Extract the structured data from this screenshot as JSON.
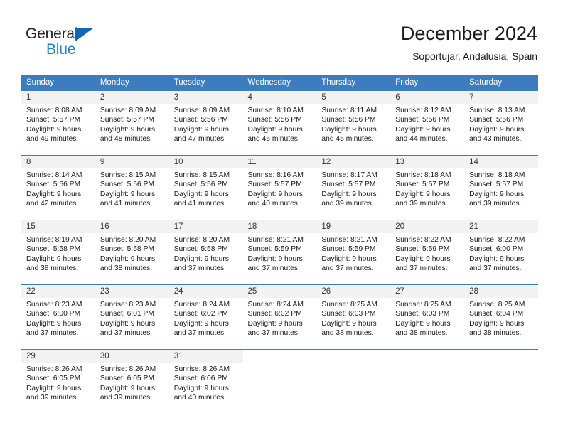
{
  "logo": {
    "text_primary": "General",
    "text_secondary": "Blue",
    "triangle_color": "#1266b5",
    "secondary_color": "#1783d0"
  },
  "header": {
    "title": "December 2024",
    "subtitle": "Soportujar, Andalusia, Spain"
  },
  "theme": {
    "header_blue": "#3d7dbf",
    "daynum_strip_bg": "#f2f2f2",
    "cell_bg": "#ffffff",
    "text": "#1a1a1a"
  },
  "weekday_headers": [
    "Sunday",
    "Monday",
    "Tuesday",
    "Wednesday",
    "Thursday",
    "Friday",
    "Saturday"
  ],
  "weeks": [
    [
      {
        "day": "1",
        "sunrise": "Sunrise: 8:08 AM",
        "sunset": "Sunset: 5:57 PM",
        "daylight_1": "Daylight: 9 hours",
        "daylight_2": "and 49 minutes."
      },
      {
        "day": "2",
        "sunrise": "Sunrise: 8:09 AM",
        "sunset": "Sunset: 5:57 PM",
        "daylight_1": "Daylight: 9 hours",
        "daylight_2": "and 48 minutes."
      },
      {
        "day": "3",
        "sunrise": "Sunrise: 8:09 AM",
        "sunset": "Sunset: 5:56 PM",
        "daylight_1": "Daylight: 9 hours",
        "daylight_2": "and 47 minutes."
      },
      {
        "day": "4",
        "sunrise": "Sunrise: 8:10 AM",
        "sunset": "Sunset: 5:56 PM",
        "daylight_1": "Daylight: 9 hours",
        "daylight_2": "and 46 minutes."
      },
      {
        "day": "5",
        "sunrise": "Sunrise: 8:11 AM",
        "sunset": "Sunset: 5:56 PM",
        "daylight_1": "Daylight: 9 hours",
        "daylight_2": "and 45 minutes."
      },
      {
        "day": "6",
        "sunrise": "Sunrise: 8:12 AM",
        "sunset": "Sunset: 5:56 PM",
        "daylight_1": "Daylight: 9 hours",
        "daylight_2": "and 44 minutes."
      },
      {
        "day": "7",
        "sunrise": "Sunrise: 8:13 AM",
        "sunset": "Sunset: 5:56 PM",
        "daylight_1": "Daylight: 9 hours",
        "daylight_2": "and 43 minutes."
      }
    ],
    [
      {
        "day": "8",
        "sunrise": "Sunrise: 8:14 AM",
        "sunset": "Sunset: 5:56 PM",
        "daylight_1": "Daylight: 9 hours",
        "daylight_2": "and 42 minutes."
      },
      {
        "day": "9",
        "sunrise": "Sunrise: 8:15 AM",
        "sunset": "Sunset: 5:56 PM",
        "daylight_1": "Daylight: 9 hours",
        "daylight_2": "and 41 minutes."
      },
      {
        "day": "10",
        "sunrise": "Sunrise: 8:15 AM",
        "sunset": "Sunset: 5:56 PM",
        "daylight_1": "Daylight: 9 hours",
        "daylight_2": "and 41 minutes."
      },
      {
        "day": "11",
        "sunrise": "Sunrise: 8:16 AM",
        "sunset": "Sunset: 5:57 PM",
        "daylight_1": "Daylight: 9 hours",
        "daylight_2": "and 40 minutes."
      },
      {
        "day": "12",
        "sunrise": "Sunrise: 8:17 AM",
        "sunset": "Sunset: 5:57 PM",
        "daylight_1": "Daylight: 9 hours",
        "daylight_2": "and 39 minutes."
      },
      {
        "day": "13",
        "sunrise": "Sunrise: 8:18 AM",
        "sunset": "Sunset: 5:57 PM",
        "daylight_1": "Daylight: 9 hours",
        "daylight_2": "and 39 minutes."
      },
      {
        "day": "14",
        "sunrise": "Sunrise: 8:18 AM",
        "sunset": "Sunset: 5:57 PM",
        "daylight_1": "Daylight: 9 hours",
        "daylight_2": "and 39 minutes."
      }
    ],
    [
      {
        "day": "15",
        "sunrise": "Sunrise: 8:19 AM",
        "sunset": "Sunset: 5:58 PM",
        "daylight_1": "Daylight: 9 hours",
        "daylight_2": "and 38 minutes."
      },
      {
        "day": "16",
        "sunrise": "Sunrise: 8:20 AM",
        "sunset": "Sunset: 5:58 PM",
        "daylight_1": "Daylight: 9 hours",
        "daylight_2": "and 38 minutes."
      },
      {
        "day": "17",
        "sunrise": "Sunrise: 8:20 AM",
        "sunset": "Sunset: 5:58 PM",
        "daylight_1": "Daylight: 9 hours",
        "daylight_2": "and 37 minutes."
      },
      {
        "day": "18",
        "sunrise": "Sunrise: 8:21 AM",
        "sunset": "Sunset: 5:59 PM",
        "daylight_1": "Daylight: 9 hours",
        "daylight_2": "and 37 minutes."
      },
      {
        "day": "19",
        "sunrise": "Sunrise: 8:21 AM",
        "sunset": "Sunset: 5:59 PM",
        "daylight_1": "Daylight: 9 hours",
        "daylight_2": "and 37 minutes."
      },
      {
        "day": "20",
        "sunrise": "Sunrise: 8:22 AM",
        "sunset": "Sunset: 5:59 PM",
        "daylight_1": "Daylight: 9 hours",
        "daylight_2": "and 37 minutes."
      },
      {
        "day": "21",
        "sunrise": "Sunrise: 8:22 AM",
        "sunset": "Sunset: 6:00 PM",
        "daylight_1": "Daylight: 9 hours",
        "daylight_2": "and 37 minutes."
      }
    ],
    [
      {
        "day": "22",
        "sunrise": "Sunrise: 8:23 AM",
        "sunset": "Sunset: 6:00 PM",
        "daylight_1": "Daylight: 9 hours",
        "daylight_2": "and 37 minutes."
      },
      {
        "day": "23",
        "sunrise": "Sunrise: 8:23 AM",
        "sunset": "Sunset: 6:01 PM",
        "daylight_1": "Daylight: 9 hours",
        "daylight_2": "and 37 minutes."
      },
      {
        "day": "24",
        "sunrise": "Sunrise: 8:24 AM",
        "sunset": "Sunset: 6:02 PM",
        "daylight_1": "Daylight: 9 hours",
        "daylight_2": "and 37 minutes."
      },
      {
        "day": "25",
        "sunrise": "Sunrise: 8:24 AM",
        "sunset": "Sunset: 6:02 PM",
        "daylight_1": "Daylight: 9 hours",
        "daylight_2": "and 37 minutes."
      },
      {
        "day": "26",
        "sunrise": "Sunrise: 8:25 AM",
        "sunset": "Sunset: 6:03 PM",
        "daylight_1": "Daylight: 9 hours",
        "daylight_2": "and 38 minutes."
      },
      {
        "day": "27",
        "sunrise": "Sunrise: 8:25 AM",
        "sunset": "Sunset: 6:03 PM",
        "daylight_1": "Daylight: 9 hours",
        "daylight_2": "and 38 minutes."
      },
      {
        "day": "28",
        "sunrise": "Sunrise: 8:25 AM",
        "sunset": "Sunset: 6:04 PM",
        "daylight_1": "Daylight: 9 hours",
        "daylight_2": "and 38 minutes."
      }
    ],
    [
      {
        "day": "29",
        "sunrise": "Sunrise: 8:26 AM",
        "sunset": "Sunset: 6:05 PM",
        "daylight_1": "Daylight: 9 hours",
        "daylight_2": "and 39 minutes."
      },
      {
        "day": "30",
        "sunrise": "Sunrise: 8:26 AM",
        "sunset": "Sunset: 6:05 PM",
        "daylight_1": "Daylight: 9 hours",
        "daylight_2": "and 39 minutes."
      },
      {
        "day": "31",
        "sunrise": "Sunrise: 8:26 AM",
        "sunset": "Sunset: 6:06 PM",
        "daylight_1": "Daylight: 9 hours",
        "daylight_2": "and 40 minutes."
      },
      {
        "day": "",
        "sunrise": "",
        "sunset": "",
        "daylight_1": "",
        "daylight_2": ""
      },
      {
        "day": "",
        "sunrise": "",
        "sunset": "",
        "daylight_1": "",
        "daylight_2": ""
      },
      {
        "day": "",
        "sunrise": "",
        "sunset": "",
        "daylight_1": "",
        "daylight_2": ""
      },
      {
        "day": "",
        "sunrise": "",
        "sunset": "",
        "daylight_1": "",
        "daylight_2": ""
      }
    ]
  ]
}
